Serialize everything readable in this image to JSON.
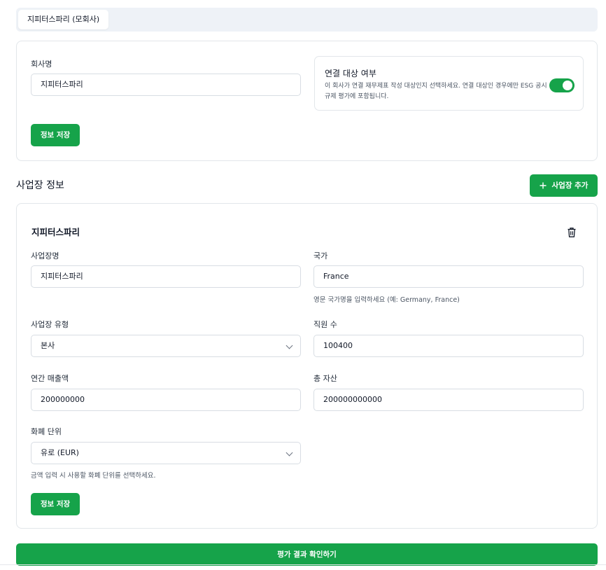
{
  "tabs": [
    {
      "label": "지피터스파리 (모회사)"
    }
  ],
  "company": {
    "name_label": "회사명",
    "name_value": "지피터스파리",
    "consolidation": {
      "title": "연결 대상 여부",
      "description": "이 회사가 연결 재무제표 작성 대상인지 선택하세요. 연결 대상인 경우에만 ESG 공시 규제 평가에 포함됩니다.",
      "enabled": true
    },
    "save_label": "정보 저장"
  },
  "sites_section": {
    "title": "사업장 정보",
    "add_label": "사업장 추가"
  },
  "site": {
    "title": "지피터스파리",
    "name_label": "사업장명",
    "name_value": "지피터스파리",
    "country_label": "국가",
    "country_value": "France",
    "country_help": "영문 국가명을 입력하세요 (예: Germany, France)",
    "type_label": "사업장 유형",
    "type_value": "본사",
    "employees_label": "직원 수",
    "employees_value": "100400",
    "revenue_label": "연간 매출액",
    "revenue_value": "200000000",
    "assets_label": "총 자산",
    "assets_value": "200000000000",
    "currency_label": "화폐 단위",
    "currency_value": "유로 (EUR)",
    "currency_help": "금액 입력 시 사용할 화폐 단위를 선택하세요.",
    "save_label": "정보 저장"
  },
  "footer": {
    "submit_label": "평가 결과 확인하기"
  },
  "colors": {
    "accent": "#16a34a"
  },
  "icons": {
    "add": "plus-icon",
    "delete": "trash-icon",
    "dropdown": "chevron-down-icon"
  }
}
